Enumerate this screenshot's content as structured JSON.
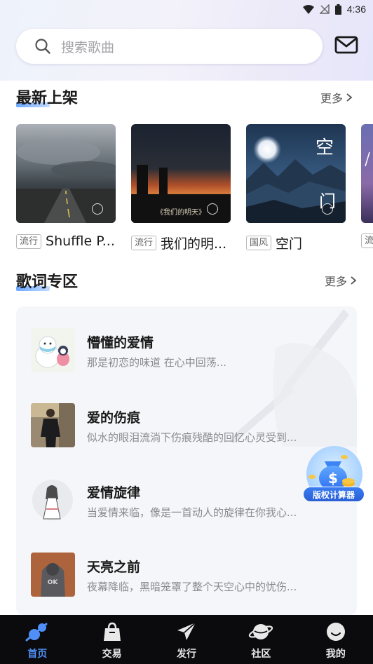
{
  "status_bar": {
    "time": "4:36"
  },
  "search": {
    "placeholder": "搜索歌曲"
  },
  "new_releases": {
    "title": "最新上架",
    "more_label": "更多",
    "items": [
      {
        "tag": "流行",
        "title": "Shuffle P..."
      },
      {
        "tag": "流行",
        "title": "我们的明..."
      },
      {
        "tag": "国风",
        "title": "空门"
      },
      {
        "tag": "流"
      }
    ],
    "cover_texts": [
      "《我们的明天》",
      "空",
      "门"
    ]
  },
  "lyrics": {
    "title": "歌词专区",
    "more_label": "更多",
    "items": [
      {
        "title": "懵懂的爱情",
        "desc": "那是初恋的味道 在心中回荡..."
      },
      {
        "title": "爱的伤痕",
        "desc": "似水的眼泪流淌下伤痕残酷的回忆心灵受到..."
      },
      {
        "title": "爱情旋律",
        "desc": "当爱情来临，像是一首动人的旋律在你我心..."
      },
      {
        "title": "天亮之前",
        "desc": "夜幕降临，黑暗笼罩了整个天空心中的忧伤..."
      }
    ]
  },
  "floating_badge": {
    "label": "版权计算器"
  },
  "tab_bar": {
    "items": [
      {
        "label": "首页",
        "icon": "home-planet-icon",
        "active": true
      },
      {
        "label": "交易",
        "icon": "bag-icon",
        "active": false
      },
      {
        "label": "发行",
        "icon": "paper-plane-icon",
        "active": false
      },
      {
        "label": "社区",
        "icon": "planet-icon",
        "active": false
      },
      {
        "label": "我的",
        "icon": "profile-face-icon",
        "active": false
      }
    ]
  },
  "colors": {
    "accent": "#4f8ff7",
    "tab_bar_bg": "#0b0b0d"
  }
}
